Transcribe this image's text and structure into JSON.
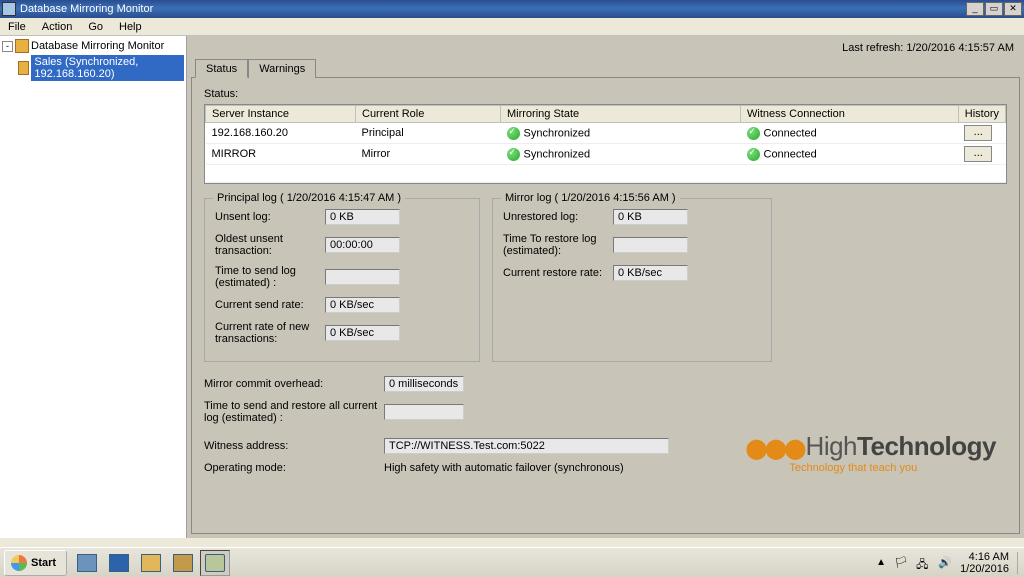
{
  "window": {
    "title": "Database Mirroring Monitor",
    "min": "_",
    "restore": "▭",
    "close": "✕"
  },
  "menu": {
    "file": "File",
    "action": "Action",
    "go": "Go",
    "help": "Help"
  },
  "tree": {
    "root": "Database Mirroring Monitor",
    "child": "Sales (Synchronized, 192.168.160.20)"
  },
  "refresh": "Last refresh: 1/20/2016 4:15:57 AM",
  "tabs": {
    "status": "Status",
    "warnings": "Warnings"
  },
  "status_label": "Status:",
  "table": {
    "headers": {
      "server": "Server Instance",
      "role": "Current Role",
      "mirroring": "Mirroring State",
      "witness": "Witness Connection",
      "history": "History"
    },
    "rows": [
      {
        "server": "192.168.160.20",
        "role": "Principal",
        "mirroring": "Synchronized",
        "witness": "Connected"
      },
      {
        "server": "MIRROR",
        "role": "Mirror",
        "mirroring": "Synchronized",
        "witness": "Connected"
      }
    ],
    "hist_btn": "..."
  },
  "principal": {
    "legend": "Principal log ( 1/20/2016 4:15:47 AM )",
    "unsent_lbl": "Unsent log:",
    "unsent_val": "0 KB",
    "oldest_lbl": "Oldest unsent transaction:",
    "oldest_val": "00:00:00",
    "tts_lbl": "Time to send log (estimated) :",
    "tts_val": "",
    "send_rate_lbl": "Current send rate:",
    "send_rate_val": "0 KB/sec",
    "new_rate_lbl": "Current rate of new transactions:",
    "new_rate_val": "0 KB/sec"
  },
  "mirror": {
    "legend": "Mirror log ( 1/20/2016 4:15:56 AM )",
    "unrest_lbl": "Unrestored log:",
    "unrest_val": "0 KB",
    "ttr_lbl": "Time To restore log (estimated):",
    "ttr_val": "",
    "restore_rate_lbl": "Current restore rate:",
    "restore_rate_val": "0 KB/sec"
  },
  "bottom": {
    "overhead_lbl": "Mirror commit overhead:",
    "overhead_val": "0 milliseconds",
    "ttsr_lbl": "Time to send and restore all current log (estimated) :",
    "ttsr_val": "",
    "witness_lbl": "Witness address:",
    "witness_val": "TCP://WITNESS.Test.com:5022",
    "opmode_lbl": "Operating mode:",
    "opmode_val": "High safety with automatic failover (synchronous)"
  },
  "logo": {
    "brand_pre": "High",
    "brand_bold": "Technology",
    "sub": "Technology that teach you"
  },
  "taskbar": {
    "start": "Start",
    "time": "4:16 AM",
    "date": "1/20/2016"
  }
}
